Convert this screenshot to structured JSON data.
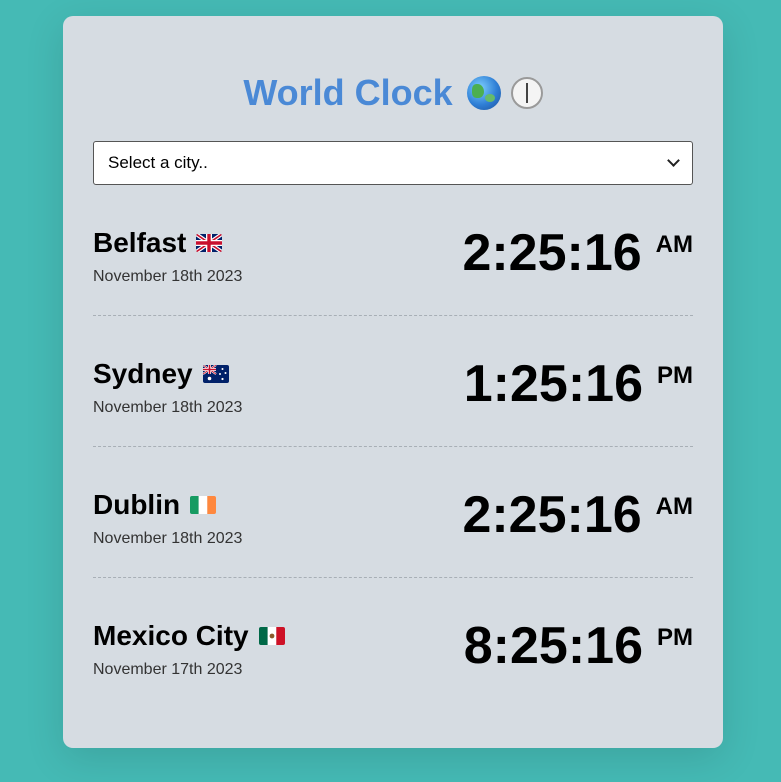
{
  "app": {
    "title": "World Clock"
  },
  "city_select": {
    "value": "Select a city.."
  },
  "cities": [
    {
      "name": "Belfast",
      "flag": "uk-flag-icon",
      "date": "November 18th 2023",
      "time": "2:25:16",
      "ampm": "AM"
    },
    {
      "name": "Sydney",
      "flag": "australia-flag-icon",
      "date": "November 18th 2023",
      "time": "1:25:16",
      "ampm": "PM"
    },
    {
      "name": "Dublin",
      "flag": "ireland-flag-icon",
      "date": "November 18th 2023",
      "time": "2:25:16",
      "ampm": "AM"
    },
    {
      "name": "Mexico City",
      "flag": "mexico-flag-icon",
      "date": "November 17th 2023",
      "time": "8:25:16",
      "ampm": "PM"
    }
  ],
  "colors": {
    "background": "#45bab5",
    "card": "#d6dce2",
    "title": "#4a89d6"
  }
}
